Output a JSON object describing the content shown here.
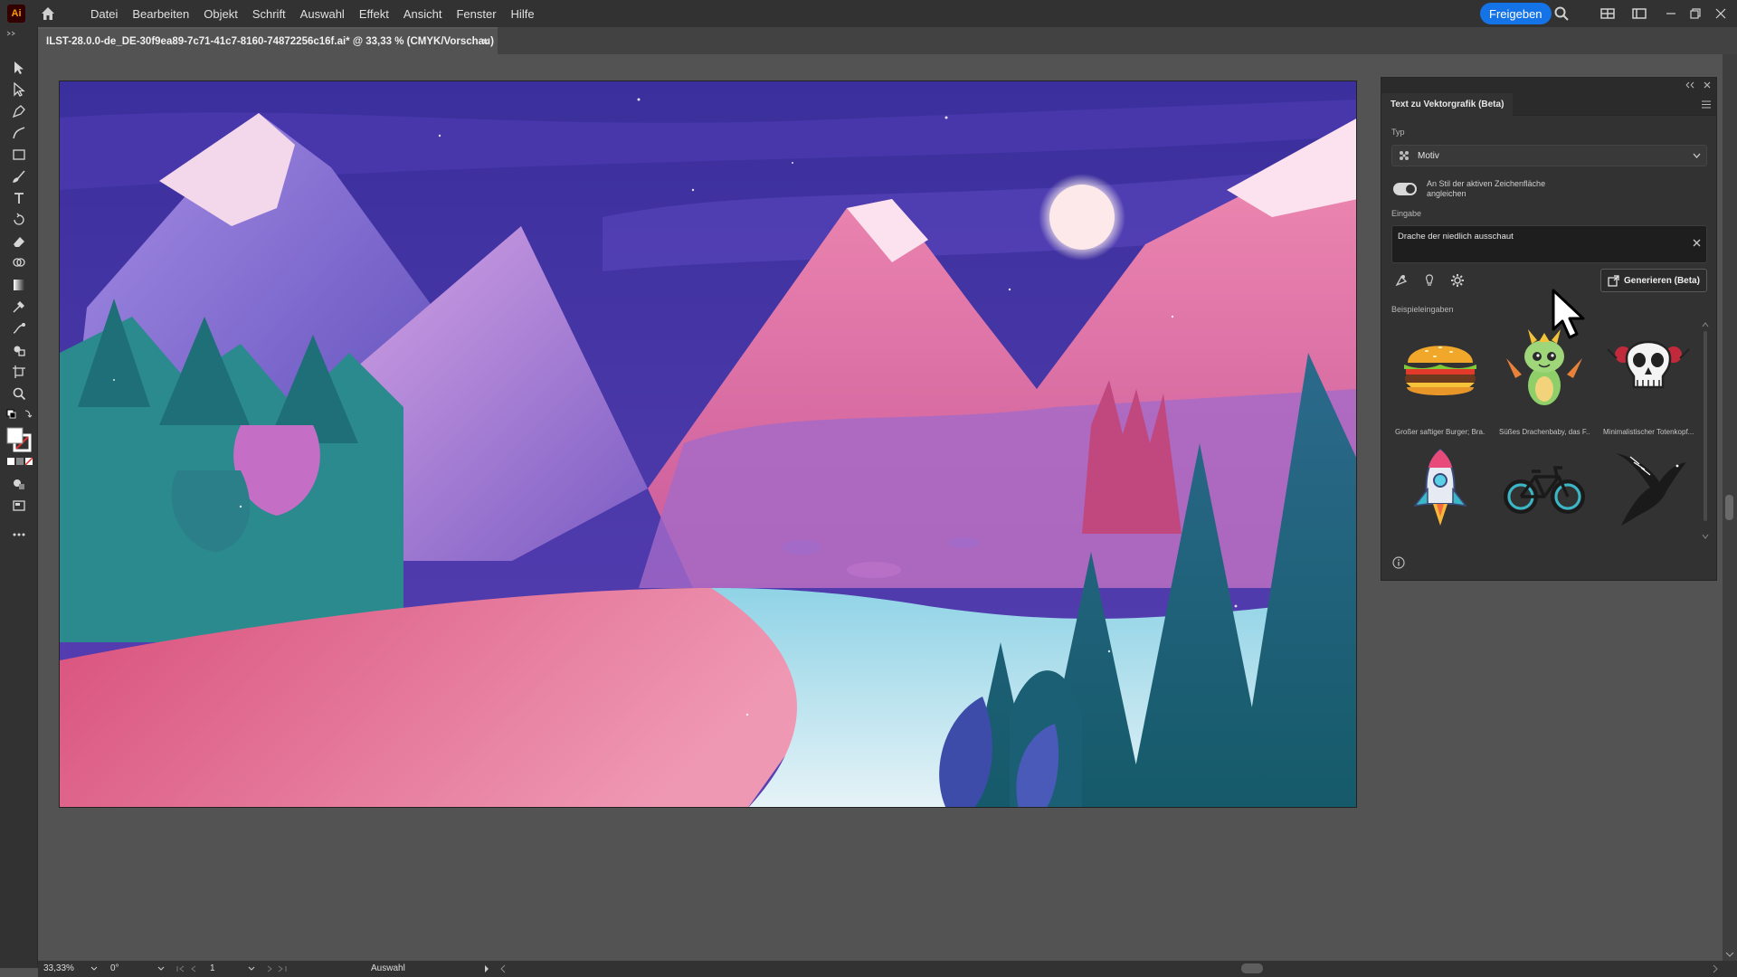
{
  "app": {
    "logo": "Ai"
  },
  "menu": [
    "Datei",
    "Bearbeiten",
    "Objekt",
    "Schrift",
    "Auswahl",
    "Effekt",
    "Ansicht",
    "Fenster",
    "Hilfe"
  ],
  "topbar": {
    "share_label": "Freigeben"
  },
  "document": {
    "tab_title": "ILST-28.0.0-de_DE-30f9ea89-7c71-41c7-8160-74872256c16f.ai* @ 33,33 % (CMYK/Vorschau)",
    "close": "×"
  },
  "panel": {
    "title": "Text zu Vektorgrafik (Beta)",
    "type_label": "Typ",
    "type_value": "Motiv",
    "toggle_label": "An Stil der aktiven Zeichenfläche angleichen",
    "toggle_on": true,
    "input_label": "Eingabe",
    "input_value": "Drache der niedlich ausschaut",
    "generate_label": "Generieren (Beta)",
    "examples_label": "Beispieleingaben",
    "examples": [
      {
        "caption": "Großer saftiger Burger; Bra..."
      },
      {
        "caption": "Süßes Drachenbaby, das F..."
      },
      {
        "caption": "Minimalistischer Totenkopf..."
      },
      {
        "caption": ""
      },
      {
        "caption": ""
      },
      {
        "caption": ""
      }
    ]
  },
  "status": {
    "zoom": "33,33%",
    "rotation": "0°",
    "artboard": "1",
    "mode": "Auswahl"
  },
  "colors": {
    "accent": "#1473e6",
    "ui_dark": "#323232",
    "canvas": "#535353"
  }
}
